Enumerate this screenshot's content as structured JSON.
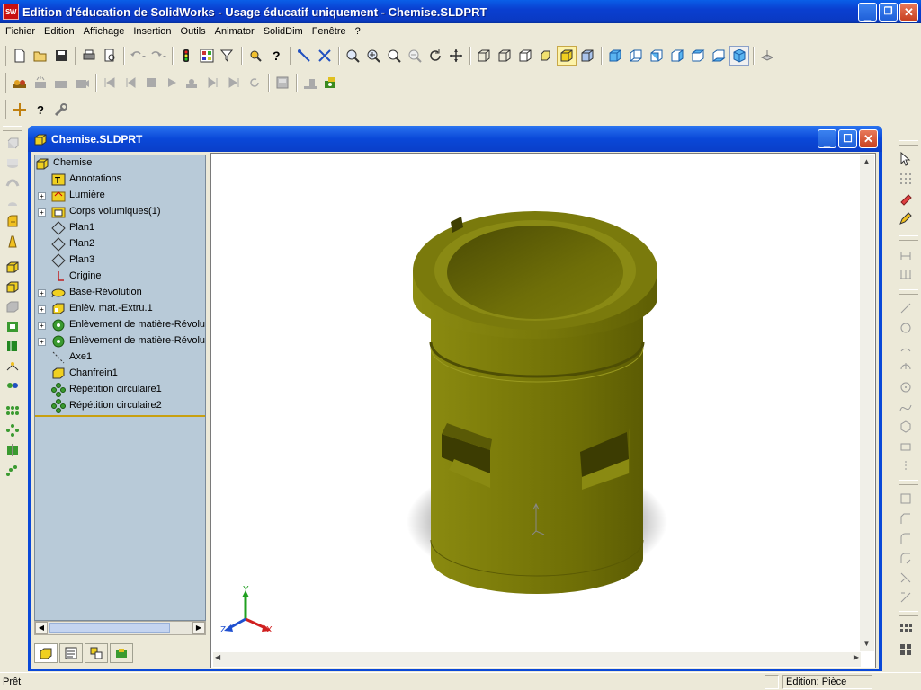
{
  "app": {
    "logo_text": "SW",
    "title": "Edition d'éducation de SolidWorks - Usage éducatif uniquement - Chemise.SLDPRT"
  },
  "menu": [
    "Fichier",
    "Edition",
    "Affichage",
    "Insertion",
    "Outils",
    "Animator",
    "SolidDim",
    "Fenêtre",
    "?"
  ],
  "document": {
    "title": "Chemise.SLDPRT"
  },
  "tree": {
    "root": "Chemise",
    "items": [
      {
        "label": "Annotations",
        "icon": "annotations-icon",
        "expandable": false
      },
      {
        "label": "Lumière",
        "icon": "light-icon",
        "expandable": true
      },
      {
        "label": "Corps volumiques(1)",
        "icon": "solid-bodies-icon",
        "expandable": true
      },
      {
        "label": "Plan1",
        "icon": "plane-icon",
        "expandable": false
      },
      {
        "label": "Plan2",
        "icon": "plane-icon",
        "expandable": false
      },
      {
        "label": "Plan3",
        "icon": "plane-icon",
        "expandable": false
      },
      {
        "label": "Origine",
        "icon": "origin-icon",
        "expandable": false
      },
      {
        "label": "Base-Révolution",
        "icon": "revolve-icon",
        "expandable": true
      },
      {
        "label": "Enlèv. mat.-Extru.1",
        "icon": "cut-extrude-icon",
        "expandable": true
      },
      {
        "label": "Enlèvement de matière-Révolu",
        "icon": "cut-revolve-icon",
        "expandable": true
      },
      {
        "label": "Enlèvement de matière-Révolu",
        "icon": "cut-revolve-icon",
        "expandable": true
      },
      {
        "label": "Axe1",
        "icon": "axis-icon",
        "expandable": false
      },
      {
        "label": "Chanfrein1",
        "icon": "chamfer-icon",
        "expandable": false
      },
      {
        "label": "Répétition circulaire1",
        "icon": "circular-pattern-icon",
        "expandable": false
      },
      {
        "label": "Répétition circulaire2",
        "icon": "circular-pattern-icon",
        "expandable": false
      }
    ]
  },
  "triad": {
    "x": "X",
    "y": "Y",
    "z": "Z"
  },
  "status": {
    "message": "Prêt",
    "mode": "Edition: Pièce"
  },
  "colors": {
    "part": "#7a7a08",
    "titlebar": "#0a48d8"
  }
}
